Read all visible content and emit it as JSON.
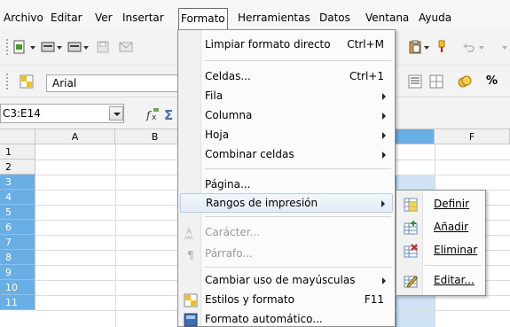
{
  "menubar": {
    "items": [
      "Archivo",
      "Editar",
      "Ver",
      "Insertar",
      "Formato",
      "Herramientas",
      "Datos",
      "Ventana",
      "Ayuda"
    ]
  },
  "toolbar": {
    "font_name": "Arial"
  },
  "formula": {
    "name_box": "C3:E14"
  },
  "grid": {
    "columns": [
      "A",
      "B",
      "F"
    ],
    "rows": [
      "1",
      "2",
      "3",
      "4",
      "5",
      "6",
      "7",
      "8",
      "9",
      "10",
      "11"
    ]
  },
  "format_menu": {
    "clear_direct": "Limpiar formato directo",
    "clear_direct_shortcut": "Ctrl+M",
    "cells": "Celdas...",
    "cells_shortcut": "Ctrl+1",
    "row": "Fila",
    "column": "Columna",
    "sheet": "Hoja",
    "merge": "Combinar celdas",
    "page": "Página...",
    "print_ranges": "Rangos de impresión",
    "character": "Carácter...",
    "paragraph": "Párrafo...",
    "change_case": "Cambiar uso de mayúsculas",
    "styles": "Estilos y formato",
    "styles_shortcut": "F11",
    "autoformat": "Formato automático..."
  },
  "print_ranges_submenu": {
    "define": "Definir",
    "add": "Añadir",
    "remove": "Eliminar",
    "edit": "Editar..."
  },
  "colors": {
    "selection": "#6aaee6",
    "menu_highlight": "#e4ecf6"
  }
}
